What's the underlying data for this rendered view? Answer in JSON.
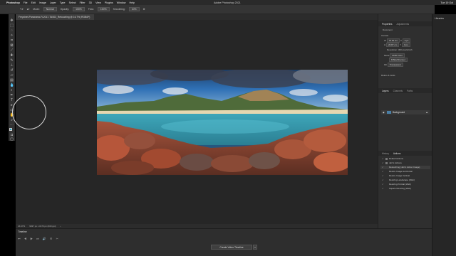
{
  "menubar": {
    "apple": "",
    "app": "Photoshop",
    "items": [
      "File",
      "Edit",
      "Image",
      "Layer",
      "Type",
      "Select",
      "Filter",
      "3D",
      "View",
      "Plugins",
      "Window",
      "Help"
    ],
    "window_title": "Adobe Photoshop 2021",
    "clock": "Tue 19 Oct"
  },
  "options": {
    "mode_label": "Mode:",
    "mode_value": "Normal",
    "opacity_label": "Opacity:",
    "opacity_value": "100%",
    "flow_label": "Flow:",
    "flow_value": "100%",
    "smoothing_label": "Smoothing:",
    "smoothing_value": "10%"
  },
  "document": {
    "tab_title": "Freycinet-Panorama-Fi-2017-TAS03_Retouching @ 16.7% (RGB/8*)"
  },
  "status": {
    "zoom": "16.67%",
    "doc_size": "9037 px x 3173 px (300 ppi)"
  },
  "timeline": {
    "title": "Timeline",
    "create_button": "Create Video Timeline"
  },
  "properties": {
    "tabs": [
      "Properties",
      "Adjustments"
    ],
    "section": "Document",
    "canvas": "Canvas",
    "w_label": "W",
    "w_value": "76.52 cm",
    "h_label": "H",
    "h_value": "26.87 cm",
    "x_label": "X",
    "x_value": "0 px",
    "y_label": "Y",
    "y_value": "0 px",
    "resolution": "Resolution: 300 pixels/inch",
    "mode_label": "Mode",
    "mode_value": "RGB Color",
    "depth_value": "8 Bits/Channel",
    "fill_label": "Fill",
    "fill_value": "Transparent",
    "rulers": "Rulers & Grids"
  },
  "layers": {
    "tabs": [
      "Layers",
      "Channels",
      "Paths"
    ],
    "items": [
      {
        "name": "Background"
      }
    ]
  },
  "history": {
    "tabs": [
      "History",
      "Actions"
    ],
    "items": [
      "Default Actions",
      "Jarr's Actions",
      "Retouching (Jarr's Action Image)",
      "Resize Image Horizontal",
      "Resize Image Vertical",
      "Resizing Landscape (Web)",
      "Resizing Portrait (Web)",
      "Square Resizing (Web)"
    ]
  },
  "libraries": {
    "title": "Libraries"
  }
}
